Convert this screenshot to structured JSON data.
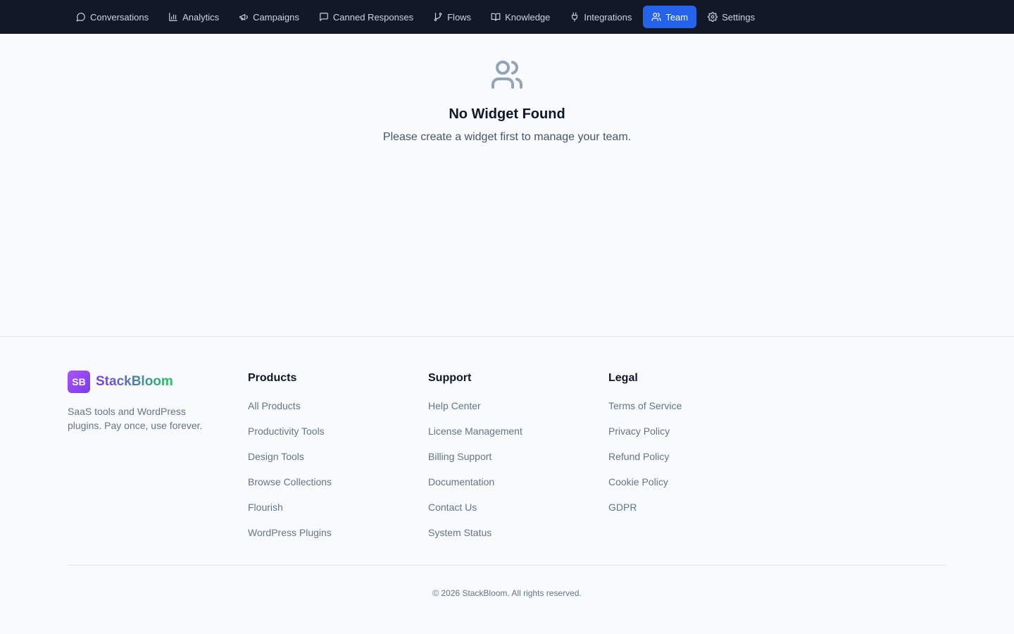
{
  "nav": {
    "items": [
      {
        "label": "Conversations",
        "icon": "chat-bubble-icon"
      },
      {
        "label": "Analytics",
        "icon": "bar-chart-icon"
      },
      {
        "label": "Campaigns",
        "icon": "megaphone-icon"
      },
      {
        "label": "Canned Responses",
        "icon": "message-square-icon"
      },
      {
        "label": "Flows",
        "icon": "git-branch-icon"
      },
      {
        "label": "Knowledge",
        "icon": "book-open-icon"
      },
      {
        "label": "Integrations",
        "icon": "plug-icon"
      },
      {
        "label": "Team",
        "icon": "users-icon",
        "active": true
      },
      {
        "label": "Settings",
        "icon": "gear-icon"
      }
    ],
    "active_color": "#2563eb",
    "background": "#111827"
  },
  "empty_state": {
    "icon": "users-icon",
    "title": "No Widget Found",
    "subtitle": "Please create a widget first to manage your team."
  },
  "footer": {
    "brand": {
      "logo_text": "SB",
      "name": "StackBloom",
      "tagline": "SaaS tools and WordPress plugins. Pay once, use forever."
    },
    "columns": [
      {
        "title": "Products",
        "links": [
          "All Products",
          "Productivity Tools",
          "Design Tools",
          "Browse Collections",
          "Flourish",
          "WordPress Plugins"
        ]
      },
      {
        "title": "Support",
        "links": [
          "Help Center",
          "License Management",
          "Billing Support",
          "Documentation",
          "Contact Us",
          "System Status"
        ]
      },
      {
        "title": "Legal",
        "links": [
          "Terms of Service",
          "Privacy Policy",
          "Refund Policy",
          "Cookie Policy",
          "GDPR"
        ]
      }
    ],
    "copyright": "© 2026 StackBloom. All rights reserved."
  }
}
